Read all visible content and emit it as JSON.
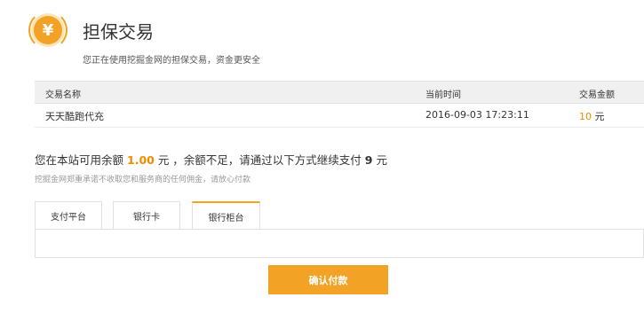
{
  "header": {
    "logo_symbol": "¥",
    "title": "担保交易",
    "subtitle": "您正在使用挖掘金网的担保交易，资金更安全"
  },
  "table": {
    "columns": [
      "交易名称",
      "当前时间",
      "交易金额"
    ],
    "rows": [
      {
        "name": "天天酷跑代充",
        "time": "2016-09-03 17:23:11",
        "amount": "10",
        "unit": "元"
      }
    ]
  },
  "balance": {
    "prefix": "您在本站可用余额",
    "amount": "1.00",
    "middle": "元 ，余额不足，请通过以下方式继续支付",
    "due": "9",
    "suffix": "元",
    "note": "挖掘金网郑重承诺不收取您和服务商的任何佣金，请放心付款"
  },
  "tabs": [
    {
      "label": "支付平台",
      "active": false
    },
    {
      "label": "银行卡",
      "active": false
    },
    {
      "label": "银行柜台",
      "active": true
    }
  ],
  "actions": {
    "confirm_label": "确认付款"
  },
  "colors": {
    "accent": "#f2a225",
    "highlight": "#f28b00"
  }
}
